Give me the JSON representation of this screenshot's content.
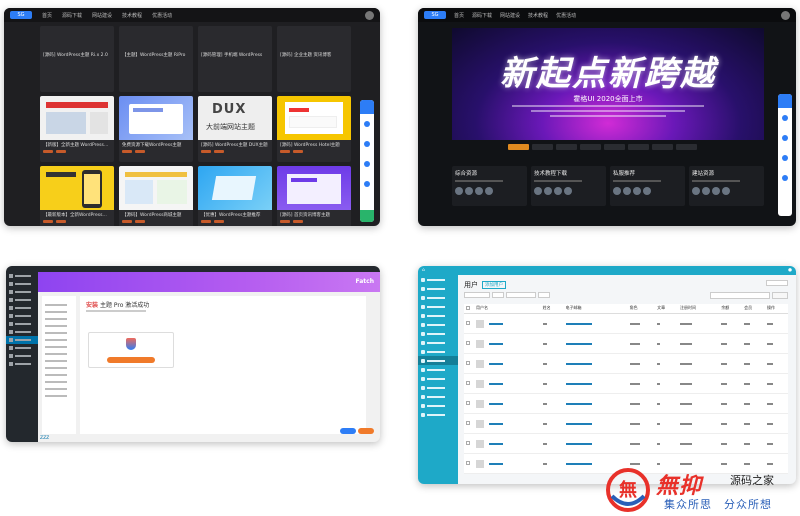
{
  "panel_dark_grid": {
    "logo": "SG",
    "nav": [
      "首页",
      "源码下载",
      "网站建设",
      "技术教程",
      "优惠活动"
    ],
    "cards": [
      {
        "title": "[源码] WordPress主题 Ri.x 2.0"
      },
      {
        "title": "【主题】WordPress主题 RiPro"
      },
      {
        "title": "[源码管理] 手机端 WordPress"
      },
      {
        "title": "[源码] 企业主题 资讯博客"
      },
      {
        "title": "【新版】全新主题 WordPress资源"
      },
      {
        "title": "免费资源下载WordPress主题"
      },
      {
        "title": "[源码] WordPress主题 DUX主题"
      },
      {
        "title": "[源码] WordPress Hotel主题"
      },
      {
        "title": "【最新版本】全新WordPress主题"
      },
      {
        "title": "【源码】WordPress商城主题"
      },
      {
        "title": "【优惠】WordPress主题推荐"
      },
      {
        "title": "[源码] 首页资讯博客主题"
      }
    ],
    "dux_logo": "DUX",
    "dux_sub": "大前端网站主题"
  },
  "panel_dark_banner": {
    "logo": "SG",
    "nav": [
      "首页",
      "源码下载",
      "网站建设",
      "技术教程",
      "优惠活动"
    ],
    "slogan": "新起点新跨越",
    "subtitle": "霍格UI 2020全面上市",
    "categories": [
      {
        "name": "综合资源"
      },
      {
        "name": "技术教程下载"
      },
      {
        "name": "私服推荐"
      },
      {
        "name": "建站资源"
      }
    ]
  },
  "panel_admin": {
    "brand": "Fatch",
    "dialog_title_prefix": "安装",
    "dialog_title_rest": "主题 Pro 激活成功"
  },
  "panel_users": {
    "page_title": "用户",
    "add_new": "添加用户",
    "columns": [
      "用户名",
      "姓名",
      "电子邮箱",
      "角色",
      "文章",
      "注册时间",
      "余额",
      "会员",
      "操作"
    ]
  },
  "watermark": {
    "seal_text": "無",
    "brand_cn": "無抑",
    "brand_name": "源码之家",
    "slogan": "集众所思　分众所想"
  },
  "colors": {
    "accent_blue": "#2d7df6",
    "admin_purple": "#8e44f0",
    "users_cyan": "#1ea9c8",
    "watermark_red": "#e8312a",
    "watermark_blue": "#2a5fb8"
  }
}
